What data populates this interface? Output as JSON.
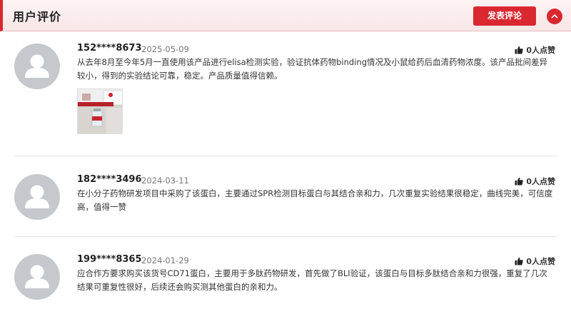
{
  "header": {
    "title": "用户评价",
    "post_button": "发表评论"
  },
  "colors": {
    "accent": "#d9282f",
    "avatar_bg": "#c5c8cd"
  },
  "reviews": [
    {
      "user": "152****8673",
      "date": "2025-05-09",
      "likes": "0人点赞",
      "text": "从去年8月至今年5月一直使用该产品进行elisa检测实验，验证抗体药物binding情况及小鼠给药后血清药物浓度。该产品批间差异较小，得到的实验结论可靠，稳定。产品质量值得信赖。",
      "has_image": true
    },
    {
      "user": "182****3496",
      "date": "2024-03-11",
      "likes": "0人点赞",
      "text": "在小分子药物研发项目中采购了该蛋白，主要通过SPR检测目标蛋白与其结合亲和力，几次重复实验结果很稳定，曲线完美，可信度高，值得一赞"
    },
    {
      "user": "199****8365",
      "date": "2024-01-29",
      "likes": "0人点赞",
      "text": "应合作方要求购买该货号CD71蛋白，主要用于多肽药物研发，首先做了BLI验证，该蛋白与目标多肽结合亲和力很强，重复了几次结果可重复性很好，后续还会购买测其他蛋白的亲和力。"
    }
  ]
}
